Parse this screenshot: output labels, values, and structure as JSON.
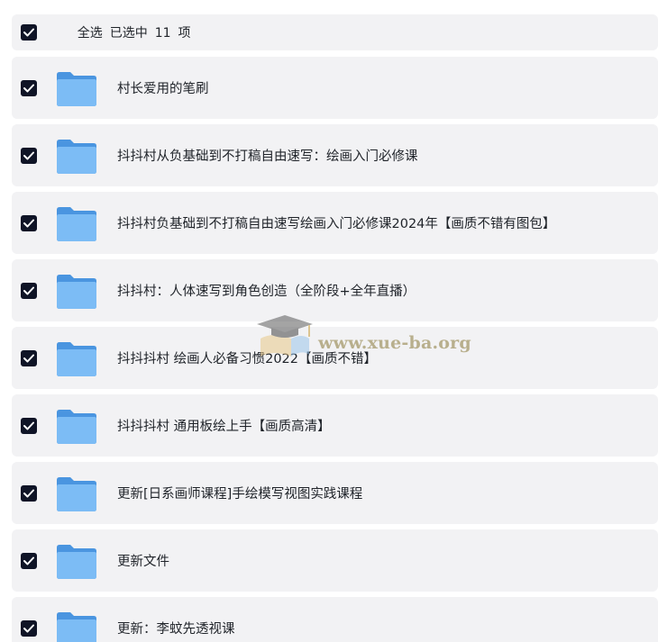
{
  "header": {
    "select_all_label": "全选",
    "selected_prefix": "已选中",
    "selected_count": "11",
    "selected_suffix": "项",
    "select_all_checked": true
  },
  "files": [
    {
      "name": "村长爱用的笔刷",
      "checked": true,
      "icon": "folder-icon"
    },
    {
      "name": "抖抖村从负基础到不打稿自由速写：绘画入门必修课",
      "checked": true,
      "icon": "folder-icon"
    },
    {
      "name": "抖抖村负基础到不打稿自由速写绘画入门必修课2024年【画质不错有图包】",
      "checked": true,
      "icon": "folder-icon"
    },
    {
      "name": "抖抖村：人体速写到角色创造（全阶段+全年直播）",
      "checked": true,
      "icon": "folder-icon"
    },
    {
      "name": "抖抖抖村 绘画人必备习惯2022【画质不错】",
      "checked": true,
      "icon": "folder-icon"
    },
    {
      "name": "抖抖抖村 通用板绘上手【画质高清】",
      "checked": true,
      "icon": "folder-icon"
    },
    {
      "name": "更新[日系画师课程]手绘模写视图实践课程",
      "checked": true,
      "icon": "folder-icon"
    },
    {
      "name": "更新文件",
      "checked": true,
      "icon": "folder-icon"
    },
    {
      "name": "更新：李蚊先透视课",
      "checked": true,
      "icon": "folder-icon"
    }
  ],
  "watermark": {
    "text": "www.xue-ba.org",
    "icon": "graduation-cap-icon"
  },
  "colors": {
    "checkbox_fill": "#0f1426",
    "row_background": "#f2f2f4",
    "folder_blue": "#5aa7ef",
    "text": "#1f2329"
  }
}
